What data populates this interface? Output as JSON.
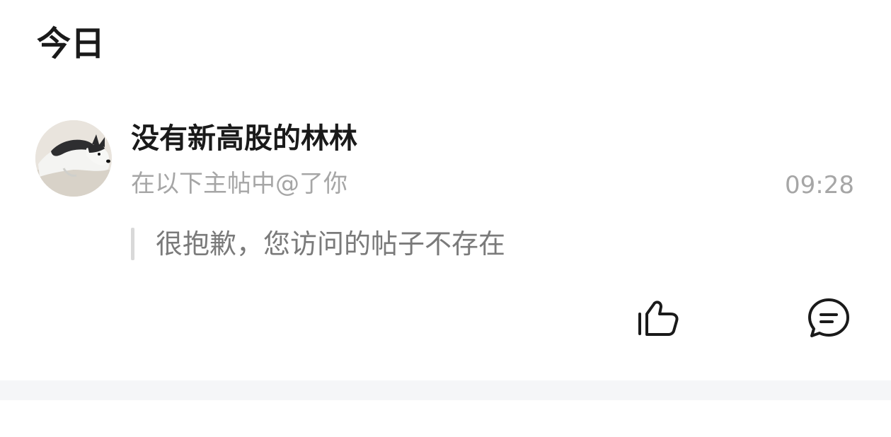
{
  "section": {
    "title": "今日"
  },
  "notification": {
    "username": "没有新高股的林林",
    "mention_text": "在以下主帖中@了你",
    "time": "09:28",
    "quoted_post": "很抱歉，您访问的帖子不存在",
    "avatar_icon": "husky-dog-avatar",
    "actions": {
      "like_icon": "thumbs-up-icon",
      "comment_icon": "comment-bubble-icon"
    }
  },
  "colors": {
    "background": "#ffffff",
    "primary_text": "#1a1a1a",
    "secondary_text": "#a6a6a6",
    "quote_text": "#7a7a7a",
    "quote_bar": "#d9d9d9",
    "divider_band": "#f5f6f8"
  }
}
